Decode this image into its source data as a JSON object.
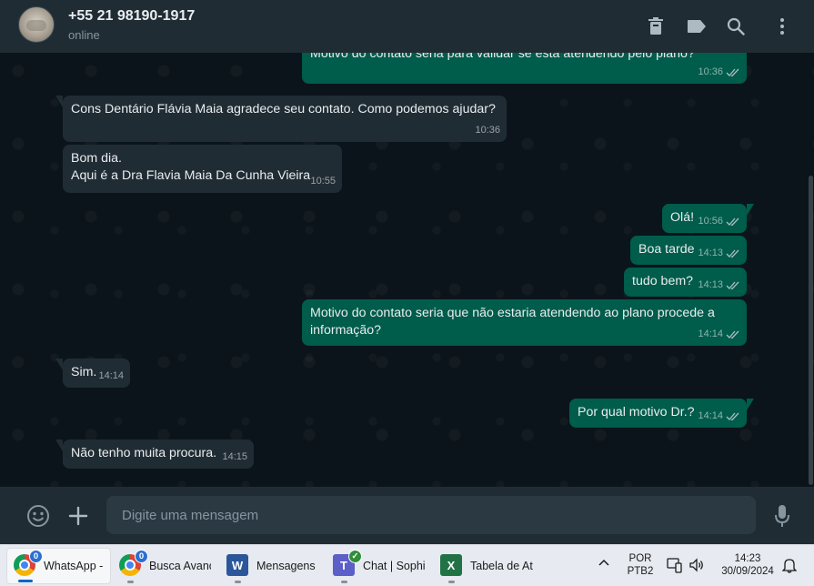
{
  "header": {
    "contact_name": "+55 21 98190-1917",
    "status": "online",
    "icons": [
      "delete-icon",
      "label-icon",
      "search-icon",
      "menu-icon"
    ]
  },
  "messages": [
    {
      "direction": "out",
      "text": "Motivo do contato seria para validar se está atendendo pelo plano?",
      "time": "10:36",
      "ticks": "read"
    },
    {
      "direction": "in",
      "text": "Cons Dentário Flávia Maia agradece seu contato. Como podemos ajudar?",
      "time": "10:36"
    },
    {
      "direction": "in",
      "text": "Bom dia.\nAqui é a Dra Flavia  Maia Da Cunha Vieira",
      "time": "10:55"
    },
    {
      "direction": "out",
      "text": "Olá!",
      "time": "10:56",
      "ticks": "read"
    },
    {
      "direction": "out",
      "text": "Boa tarde",
      "time": "14:13",
      "ticks": "read"
    },
    {
      "direction": "out",
      "text": "tudo bem?",
      "time": "14:13",
      "ticks": "read"
    },
    {
      "direction": "out",
      "text": "Motivo do contato seria que não estaria atendendo ao plano procede a informação?",
      "time": "14:14",
      "ticks": "read"
    },
    {
      "direction": "in",
      "text": "Sim.",
      "time": "14:14"
    },
    {
      "direction": "out",
      "text": "Por qual motivo Dr.?",
      "time": "14:14",
      "ticks": "read"
    },
    {
      "direction": "in",
      "text": "Não tenho muita procura.",
      "time": "14:15"
    }
  ],
  "composer": {
    "placeholder": "Digite uma mensagem",
    "icons": [
      "emoji-icon",
      "attach-plus-icon",
      "microphone-icon"
    ]
  },
  "colors": {
    "header_bg": "#202c33",
    "chat_bg": "#0b141a",
    "incoming_bubble": "#202c33",
    "outgoing_bubble": "#005c4b",
    "read_tick": "#8696a0"
  },
  "taskbar": {
    "apps": [
      {
        "label": "WhatsApp -",
        "icon": "chrome-icon",
        "badge": "0",
        "active": true
      },
      {
        "label": "Busca Avanç",
        "icon": "chrome-icon",
        "badge": "0",
        "active": false
      },
      {
        "label": "Mensagens |",
        "icon": "word-icon",
        "active": false
      },
      {
        "label": "Chat | Sophi",
        "icon": "teams-icon",
        "badge_icon": "check-icon",
        "active": false
      },
      {
        "label": "Tabela de At",
        "icon": "excel-icon",
        "active": false
      }
    ],
    "tray": {
      "language_line1": "POR",
      "language_line2": "PTB2",
      "time": "14:23",
      "date": "30/09/2024"
    }
  }
}
